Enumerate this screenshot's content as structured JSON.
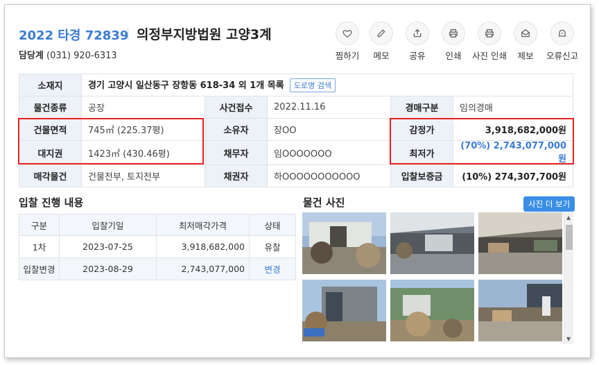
{
  "header": {
    "case_number": "2022 타경 72839",
    "court": "의정부지방법원 고양3계",
    "contact_label": "담당계",
    "contact_phone": "(031) 920-6313"
  },
  "actions": [
    {
      "label": "찜하기",
      "icon": "heart-icon"
    },
    {
      "label": "메모",
      "icon": "pencil-icon"
    },
    {
      "label": "공유",
      "icon": "share-icon"
    },
    {
      "label": "인쇄",
      "icon": "printer-icon"
    },
    {
      "label": "사진 인쇄",
      "icon": "printer-icon"
    },
    {
      "label": "제보",
      "icon": "envelope-icon"
    },
    {
      "label": "오류신고",
      "icon": "alert-icon"
    }
  ],
  "info": {
    "location_label": "소재지",
    "location_value": "경기 고양시 일산동구 장항동 618-34 외 1개 목록",
    "road_search": "도로명 검색",
    "type_label": "물건종류",
    "type_value": "공장",
    "received_label": "사건접수",
    "received_value": "2022.11.16",
    "auction_type_label": "경매구분",
    "auction_type_value": "임의경매",
    "building_area_label": "건물면적",
    "building_area_value": "745㎡ (225.37평)",
    "owner_label": "소유자",
    "owner_value": "장OO",
    "appraisal_label": "감정가",
    "appraisal_value": "3,918,682,000원",
    "land_label": "대지권",
    "land_value": "1423㎡ (430.46평)",
    "debtor_label": "채무자",
    "debtor_value": "임OOOOOOO",
    "min_price_label": "최저가",
    "min_price_value": "(70%) 2,743,077,000원",
    "sale_object_label": "매각물건",
    "sale_object_value": "건물전부, 토지전부",
    "creditor_label": "채권자",
    "creditor_value": "하OOOOOOOOOOO",
    "deposit_label": "입찰보증금",
    "deposit_value": "(10%) 274,307,700원"
  },
  "bidding": {
    "title": "입찰 진행 내용",
    "headers": [
      "구분",
      "입찰기일",
      "최저매각가격",
      "상태"
    ],
    "rows": [
      [
        "1차",
        "2023-07-25",
        "3,918,682,000",
        "유찰"
      ],
      [
        "입찰변경",
        "2023-08-29",
        "2,743,077,000",
        "변경"
      ]
    ]
  },
  "photos": {
    "title": "물건 사진",
    "more_button": "사진 더 보기"
  },
  "colors": {
    "accent": "#3a7bd5",
    "highlight_box": "#e8201f",
    "header_cell": "#edf2f8"
  }
}
